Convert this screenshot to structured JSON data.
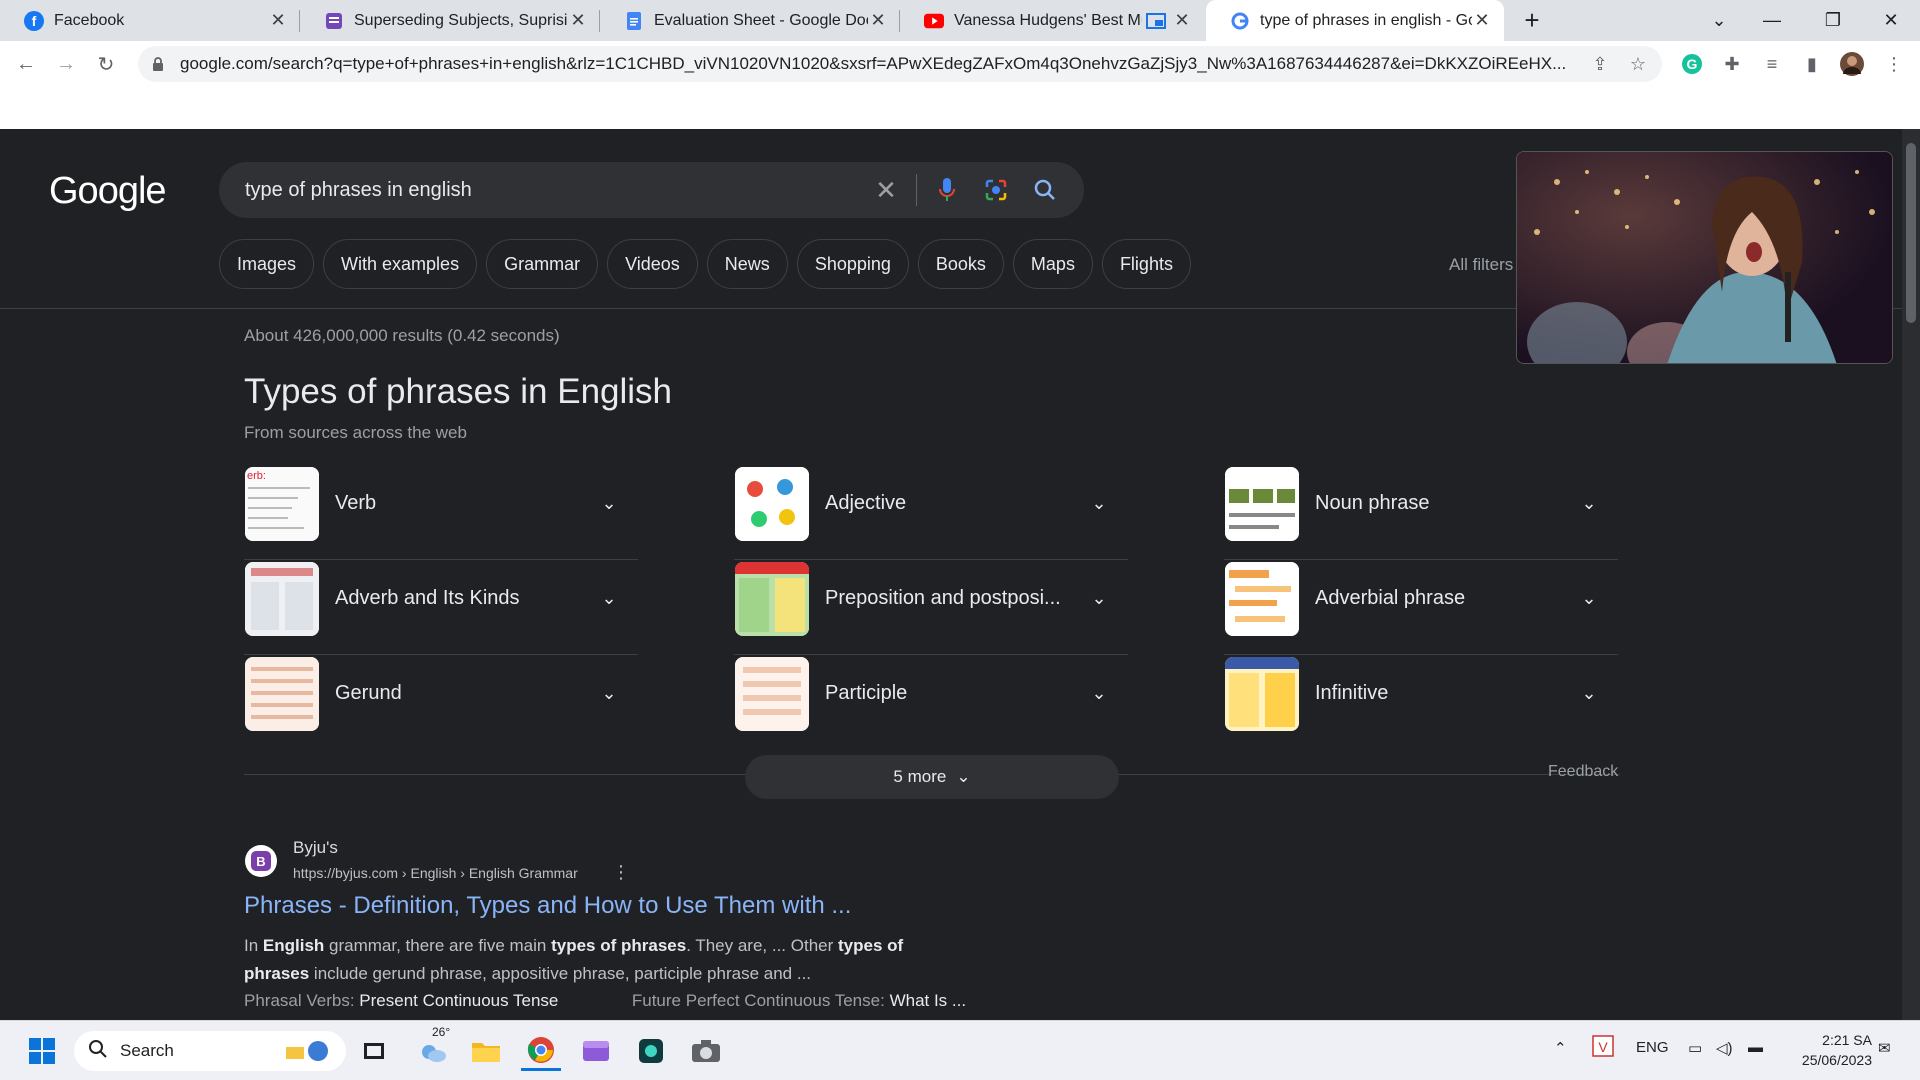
{
  "browser": {
    "tabs": [
      {
        "title": "Facebook",
        "icon": "facebook-icon",
        "color": "#1877f2"
      },
      {
        "title": "Superseding Subjects, Suprising S",
        "icon": "form-icon",
        "color": "#7248b9"
      },
      {
        "title": "Evaluation Sheet - Google Docs",
        "icon": "docs-icon",
        "color": "#4285f4"
      },
      {
        "title": "Vanessa Hudgens' Best Musi",
        "icon": "youtube-icon",
        "color": "#ff0000"
      },
      {
        "title": "type of phrases in english - Goog",
        "icon": "google-icon",
        "color": "#4285f4",
        "active": true
      }
    ],
    "url": "google.com/search?q=type+of+phrases+in+english&rlz=1C1CHBD_viVN1020VN1020&sxsrf=APwXEdegZAFxOm4q3OnehvzGaZjSjy3_Nw%3A1687634446287&ei=DkKXZOiREeHX..."
  },
  "google": {
    "logo": "Google",
    "query": "type of phrases in english",
    "chips": [
      "Images",
      "With examples",
      "Grammar",
      "Videos",
      "News",
      "Shopping",
      "Books",
      "Maps",
      "Flights"
    ],
    "all_filters": "All filters",
    "stats": "About 426,000,000 results (0.42 seconds)",
    "section_title": "Types of phrases in English",
    "section_subtitle": "From sources across the web",
    "items": [
      {
        "label": "Verb"
      },
      {
        "label": "Adjective"
      },
      {
        "label": "Noun phrase"
      },
      {
        "label": "Adverb and Its Kinds"
      },
      {
        "label": "Preposition and postposi..."
      },
      {
        "label": "Adverbial phrase"
      },
      {
        "label": "Gerund"
      },
      {
        "label": "Participle"
      },
      {
        "label": "Infinitive"
      }
    ],
    "more_button": "5 more",
    "feedback": "Feedback",
    "result": {
      "site": "Byju's",
      "url": "https://byjus.com › English › English Grammar",
      "title": "Phrases - Definition, Types and How to Use Them with ...",
      "snippet_parts": [
        {
          "t": "In ",
          "b": false
        },
        {
          "t": "English",
          "b": true
        },
        {
          "t": " grammar, there are five main ",
          "b": false
        },
        {
          "t": "types of phrases",
          "b": true
        },
        {
          "t": ". They are, ... Other ",
          "b": false
        },
        {
          "t": "types of phrases",
          "b": true
        },
        {
          "t": " include gerund phrase, appositive phrase, participle phrase and ...",
          "b": false
        }
      ],
      "link1_label": "Phrasal Verbs:",
      "link1_value": "Present Continuous Tense",
      "link2_label": "Future Perfect Continuous Tense:",
      "link2_value": "What Is ..."
    }
  },
  "taskbar": {
    "search_label": "Search",
    "weather": "26°",
    "language": "ENG",
    "time": "2:21 SA",
    "date": "25/06/2023"
  },
  "colors": {
    "page_bg": "#202124",
    "link_blue": "#8ab4f8",
    "surface": "#303134"
  }
}
